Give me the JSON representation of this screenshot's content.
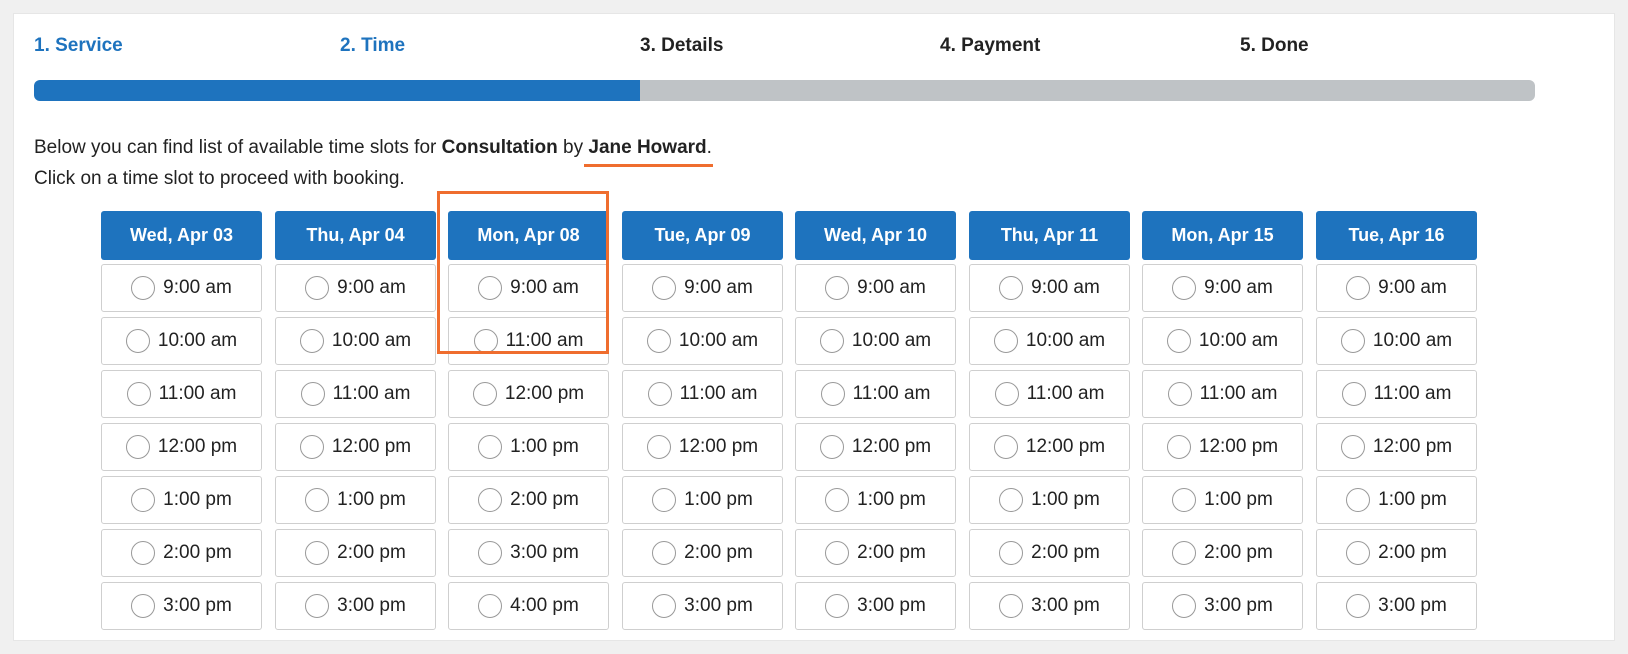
{
  "steps": [
    {
      "label": "1. Service",
      "state": "done"
    },
    {
      "label": "2. Time",
      "state": "current"
    },
    {
      "label": "3. Details",
      "state": "pending"
    },
    {
      "label": "4. Payment",
      "state": "pending"
    },
    {
      "label": "5. Done",
      "state": "pending"
    }
  ],
  "intro": {
    "line1_before": "Below you can find list of available time slots for ",
    "service": "Consultation",
    "line1_by": " by ",
    "staff": "Jane Howard",
    "line1_end": ".",
    "line2": "Click on a time slot to proceed with booking."
  },
  "days": [
    {
      "date": "Wed, Apr 03",
      "slots": [
        "9:00 am",
        "10:00 am",
        "11:00 am",
        "12:00 pm",
        "1:00 pm",
        "2:00 pm",
        "3:00 pm"
      ]
    },
    {
      "date": "Thu, Apr 04",
      "slots": [
        "9:00 am",
        "10:00 am",
        "11:00 am",
        "12:00 pm",
        "1:00 pm",
        "2:00 pm",
        "3:00 pm"
      ]
    },
    {
      "date": "Mon, Apr 08",
      "slots": [
        "9:00 am",
        "11:00 am",
        "12:00 pm",
        "1:00 pm",
        "2:00 pm",
        "3:00 pm",
        "4:00 pm"
      ]
    },
    {
      "date": "Tue, Apr 09",
      "slots": [
        "9:00 am",
        "10:00 am",
        "11:00 am",
        "12:00 pm",
        "1:00 pm",
        "2:00 pm",
        "3:00 pm"
      ]
    },
    {
      "date": "Wed, Apr 10",
      "slots": [
        "9:00 am",
        "10:00 am",
        "11:00 am",
        "12:00 pm",
        "1:00 pm",
        "2:00 pm",
        "3:00 pm"
      ]
    },
    {
      "date": "Thu, Apr 11",
      "slots": [
        "9:00 am",
        "10:00 am",
        "11:00 am",
        "12:00 pm",
        "1:00 pm",
        "2:00 pm",
        "3:00 pm"
      ]
    },
    {
      "date": "Mon, Apr 15",
      "slots": [
        "9:00 am",
        "10:00 am",
        "11:00 am",
        "12:00 pm",
        "1:00 pm",
        "2:00 pm",
        "3:00 pm"
      ]
    },
    {
      "date": "Tue, Apr 16",
      "slots": [
        "9:00 am",
        "10:00 am",
        "11:00 am",
        "12:00 pm",
        "1:00 pm",
        "2:00 pm",
        "3:00 pm"
      ]
    }
  ],
  "colors": {
    "primary": "#1e73be",
    "pending_bar": "#bfc3c6",
    "highlight": "#ef6d2e"
  }
}
